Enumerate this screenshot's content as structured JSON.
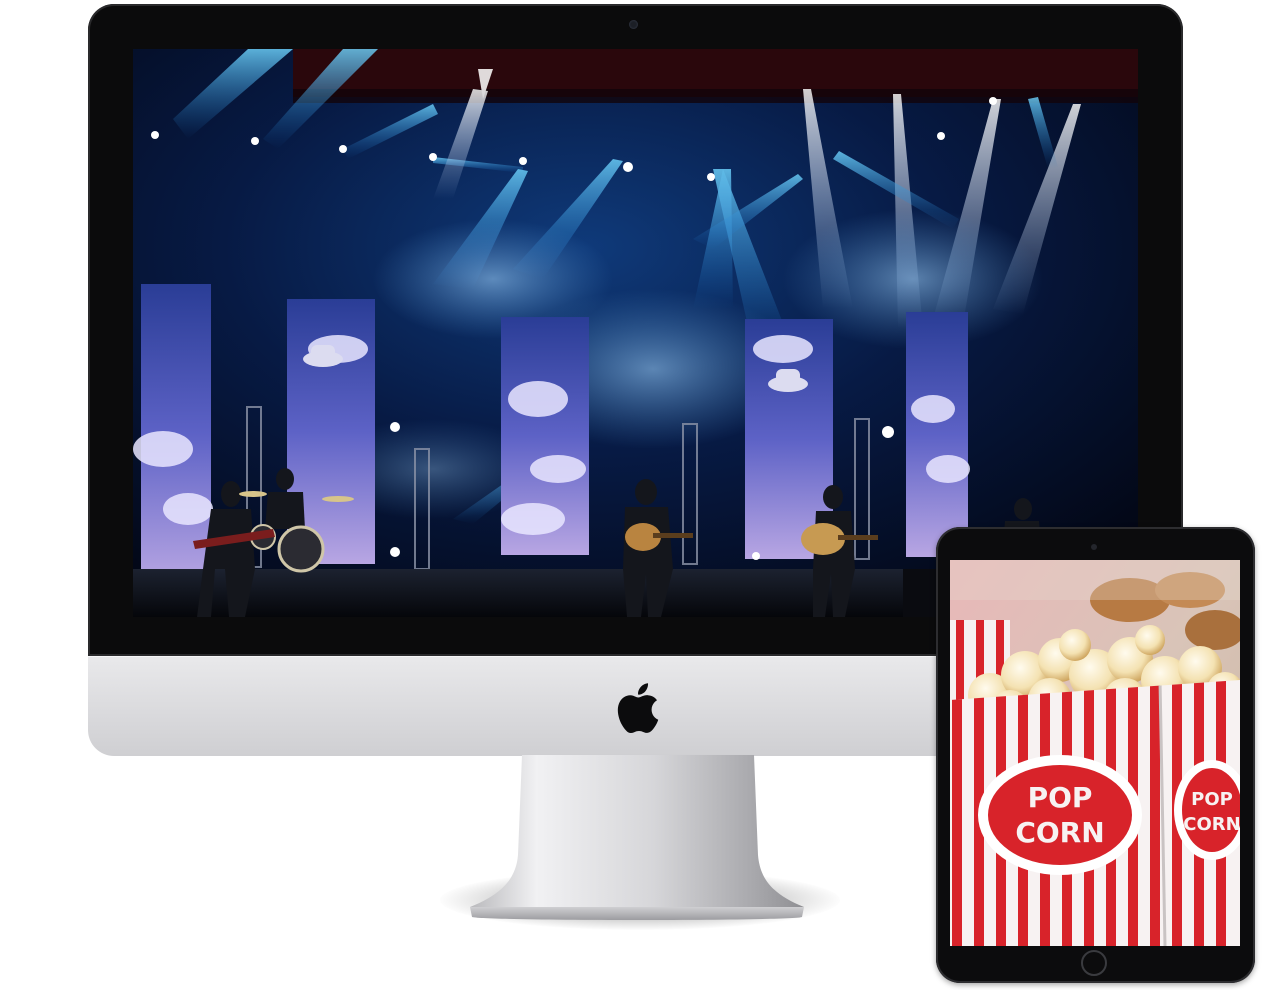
{
  "imac": {
    "screen_scene": "concert-stage-photo"
  },
  "ipad": {
    "screen_scene": "popcorn-box-photo",
    "popcorn_box_text_front": [
      "POP",
      "CORN"
    ],
    "popcorn_box_text_side": [
      "POP",
      "CORN"
    ]
  },
  "colors": {
    "stage_background": "#04081c",
    "stage_light_blue": "#2fb3ff",
    "popcorn_red": "#d8232a",
    "device_bezel": "#0b0b0c",
    "imac_chin": "#dcdcdf"
  },
  "icons": {
    "imac_logo": "apple-logo-icon",
    "ipad_home": "home-button-icon"
  }
}
